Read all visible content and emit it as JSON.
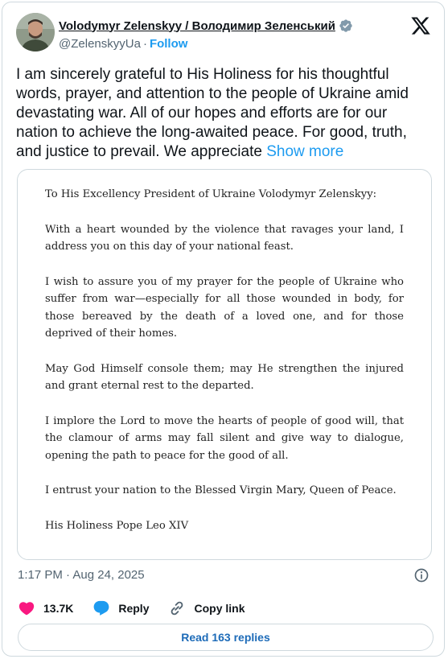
{
  "author": {
    "name": "Volodymyr Zelenskyy / Володимир Зеленський",
    "handle": "@ZelenskyyUa",
    "separator": "·",
    "follow_label": "Follow",
    "verified_icon": "verified-badge-icon"
  },
  "tweet": {
    "text": "I am sincerely grateful to His Holiness for his thoughtful words, prayer, and attention to the people of Ukraine amid devastating war. All of our hopes and efforts are for our nation to achieve the long-awaited peace. For good, truth, and justice to prevail. We appreciate ",
    "show_more_label": "Show more"
  },
  "letter": {
    "salutation": "To His Excellency President of Ukraine Volodymyr Zelenskyy:",
    "paragraphs": [
      "With a heart wounded by the violence that ravages your land, I address you on this day of your national feast.",
      "I wish to assure you of my prayer for the people of Ukraine who suffer from war—especially for all those wounded in body, for those bereaved by the death of a loved one, and for those deprived of their homes.",
      "May God Himself console them; may He strengthen the injured and grant eternal rest to the departed.",
      "I implore the Lord to move the hearts of people of good will, that the clamour of arms may fall silent and give way to dialogue, opening the path to peace for the good of all.",
      "I entrust your nation to the Blessed Virgin Mary, Queen of Peace."
    ],
    "signature": "His Holiness Pope Leo XIV"
  },
  "meta": {
    "timestamp": "1:17 PM · Aug 24, 2025"
  },
  "actions": {
    "likes": "13.7K",
    "reply_label": "Reply",
    "copy_link_label": "Copy link"
  },
  "replies_button": "Read 163 replies",
  "colors": {
    "accent": "#1d9bf0",
    "like": "#f91880",
    "muted": "#536471",
    "border": "#cfd9de"
  }
}
